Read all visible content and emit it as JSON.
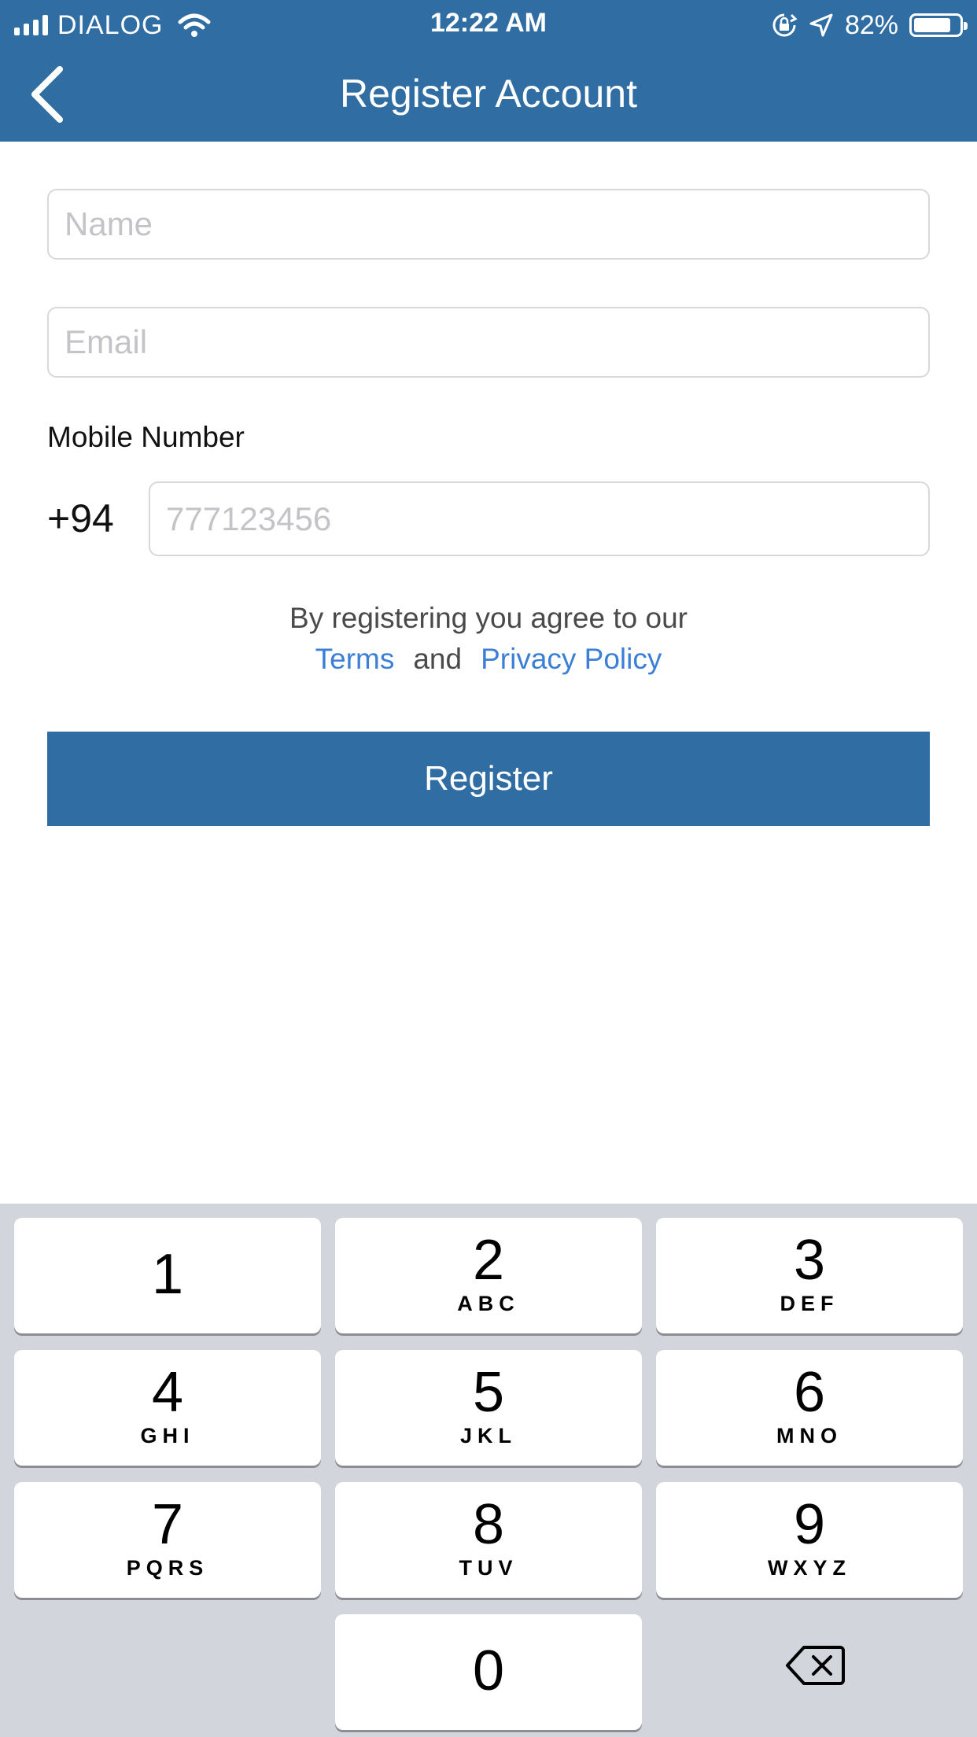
{
  "status_bar": {
    "carrier": "DIALOG",
    "time": "12:22 AM",
    "battery_percent": "82%",
    "battery_level": 0.82,
    "icons": [
      "signal-icon",
      "wifi-icon",
      "rotation-lock-icon",
      "location-icon",
      "battery-icon"
    ]
  },
  "nav": {
    "title": "Register Account",
    "back_icon": "chevron-left-icon"
  },
  "form": {
    "name_placeholder": "Name",
    "email_placeholder": "Email",
    "mobile_label": "Mobile Number",
    "country_code": "+94",
    "mobile_placeholder": "777123456",
    "agree_text": "By registering you agree to our",
    "terms_link": "Terms",
    "and_text": "and",
    "privacy_link": "Privacy Policy",
    "register_label": "Register"
  },
  "keypad": {
    "keys": [
      {
        "num": "1",
        "letters": ""
      },
      {
        "num": "2",
        "letters": "ABC"
      },
      {
        "num": "3",
        "letters": "DEF"
      },
      {
        "num": "4",
        "letters": "GHI"
      },
      {
        "num": "5",
        "letters": "JKL"
      },
      {
        "num": "6",
        "letters": "MNO"
      },
      {
        "num": "7",
        "letters": "PQRS"
      },
      {
        "num": "8",
        "letters": "TUV"
      },
      {
        "num": "9",
        "letters": "WXYZ"
      },
      {
        "num": "0",
        "letters": ""
      }
    ],
    "delete_icon": "backspace-icon"
  },
  "colors": {
    "header": "#2f6da3",
    "link": "#3b7fd6",
    "button": "#2f6da3",
    "keypad_bg": "#d2d5db"
  }
}
